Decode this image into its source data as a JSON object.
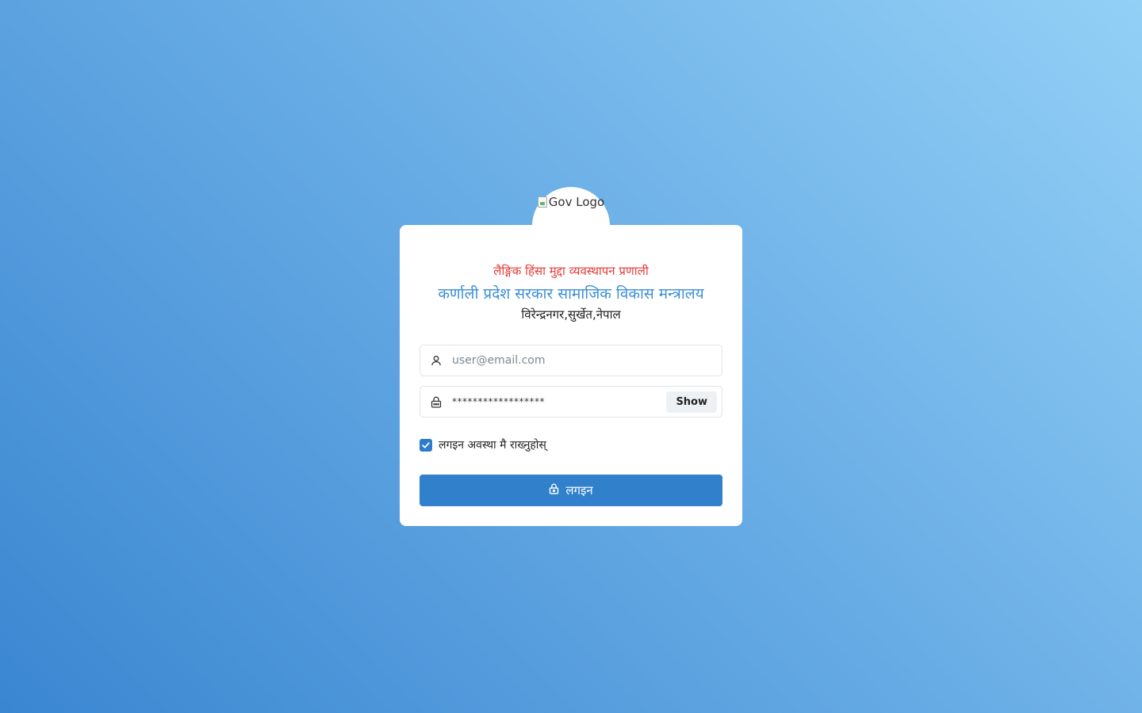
{
  "logo": {
    "alt_text": "Gov Logo"
  },
  "header": {
    "system_title": "लैङ्गिक हिंसा मुद्दा व्यवस्थापन प्रणाली",
    "ministry_title": "कर्णाली प्रदेश सरकार सामाजिक विकास मन्त्रालय",
    "location": "विरेन्द्रनगर,सुर्खेत,नेपाल"
  },
  "form": {
    "email": {
      "placeholder": "user@email.com",
      "value": "",
      "icon": "user-icon"
    },
    "password": {
      "value": "******************",
      "icon": "lock-icon",
      "show_label": "Show"
    },
    "remember": {
      "label": "लगइन अवस्था मै राख्नुहोस्",
      "checked": true
    },
    "login_button": {
      "label": "लगइन",
      "icon": "lock-icon"
    }
  },
  "colors": {
    "accent": "#3080cc",
    "title_red": "#e53935",
    "title_blue": "#3b8fd6"
  }
}
